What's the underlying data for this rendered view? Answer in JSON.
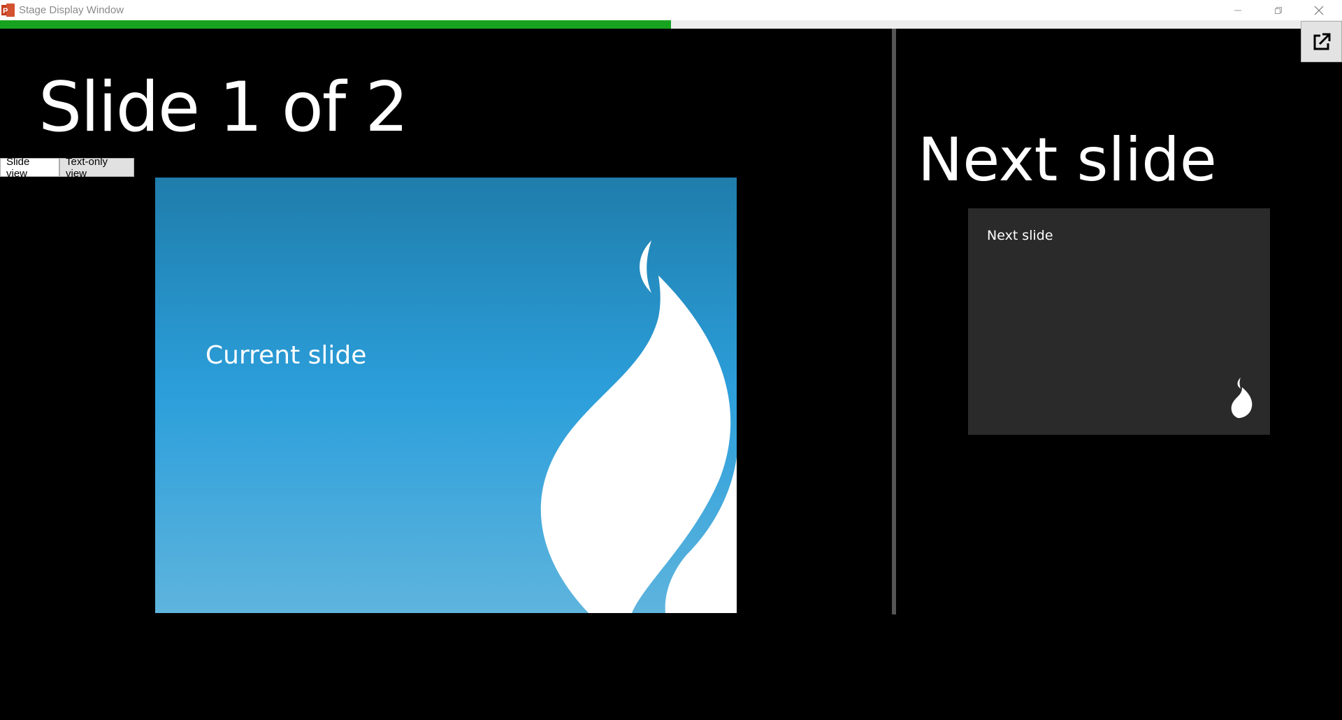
{
  "window": {
    "title": "Stage Display Window",
    "app_icon": "powerpoint-icon",
    "controls": [
      "minimize-icon",
      "restore-icon",
      "close-icon"
    ]
  },
  "progress": {
    "fraction": 0.5,
    "color": "#17a320"
  },
  "popout_button": {
    "icon": "popout-icon"
  },
  "current": {
    "heading": "Slide 1 of 2",
    "view_buttons": {
      "slide_view": "Slide view",
      "text_only_view": "Text-only view"
    },
    "slide_text": "Current slide",
    "background_top": "#1f7dab",
    "background_bottom": "#5eb4dd"
  },
  "next": {
    "heading": "Next slide",
    "slide_text": "Next slide",
    "background": "#2a2a2a"
  }
}
